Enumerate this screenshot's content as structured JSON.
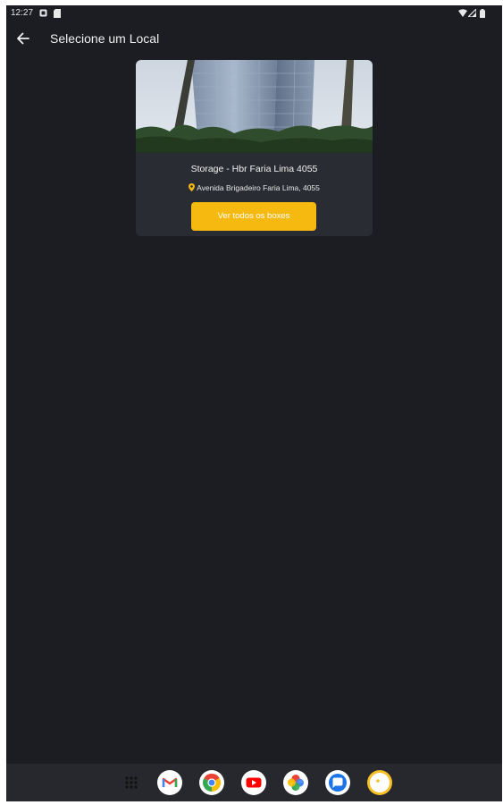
{
  "status_bar": {
    "time": "12:27"
  },
  "app_bar": {
    "title": "Selecione um Local"
  },
  "location_card": {
    "title": "Storage - Hbr Faria Lima 4055",
    "address": "Avenida Brigadeiro Faria Lima, 4055",
    "button_label": "Ver todos os boxes"
  },
  "dock": {
    "apps": [
      "app-drawer",
      "gmail",
      "chrome",
      "youtube",
      "photos",
      "messages",
      "keep"
    ]
  },
  "colors": {
    "background": "#1c1d23",
    "card": "#2a2c33",
    "accent": "#f6b90f",
    "dock": "#27282e"
  }
}
